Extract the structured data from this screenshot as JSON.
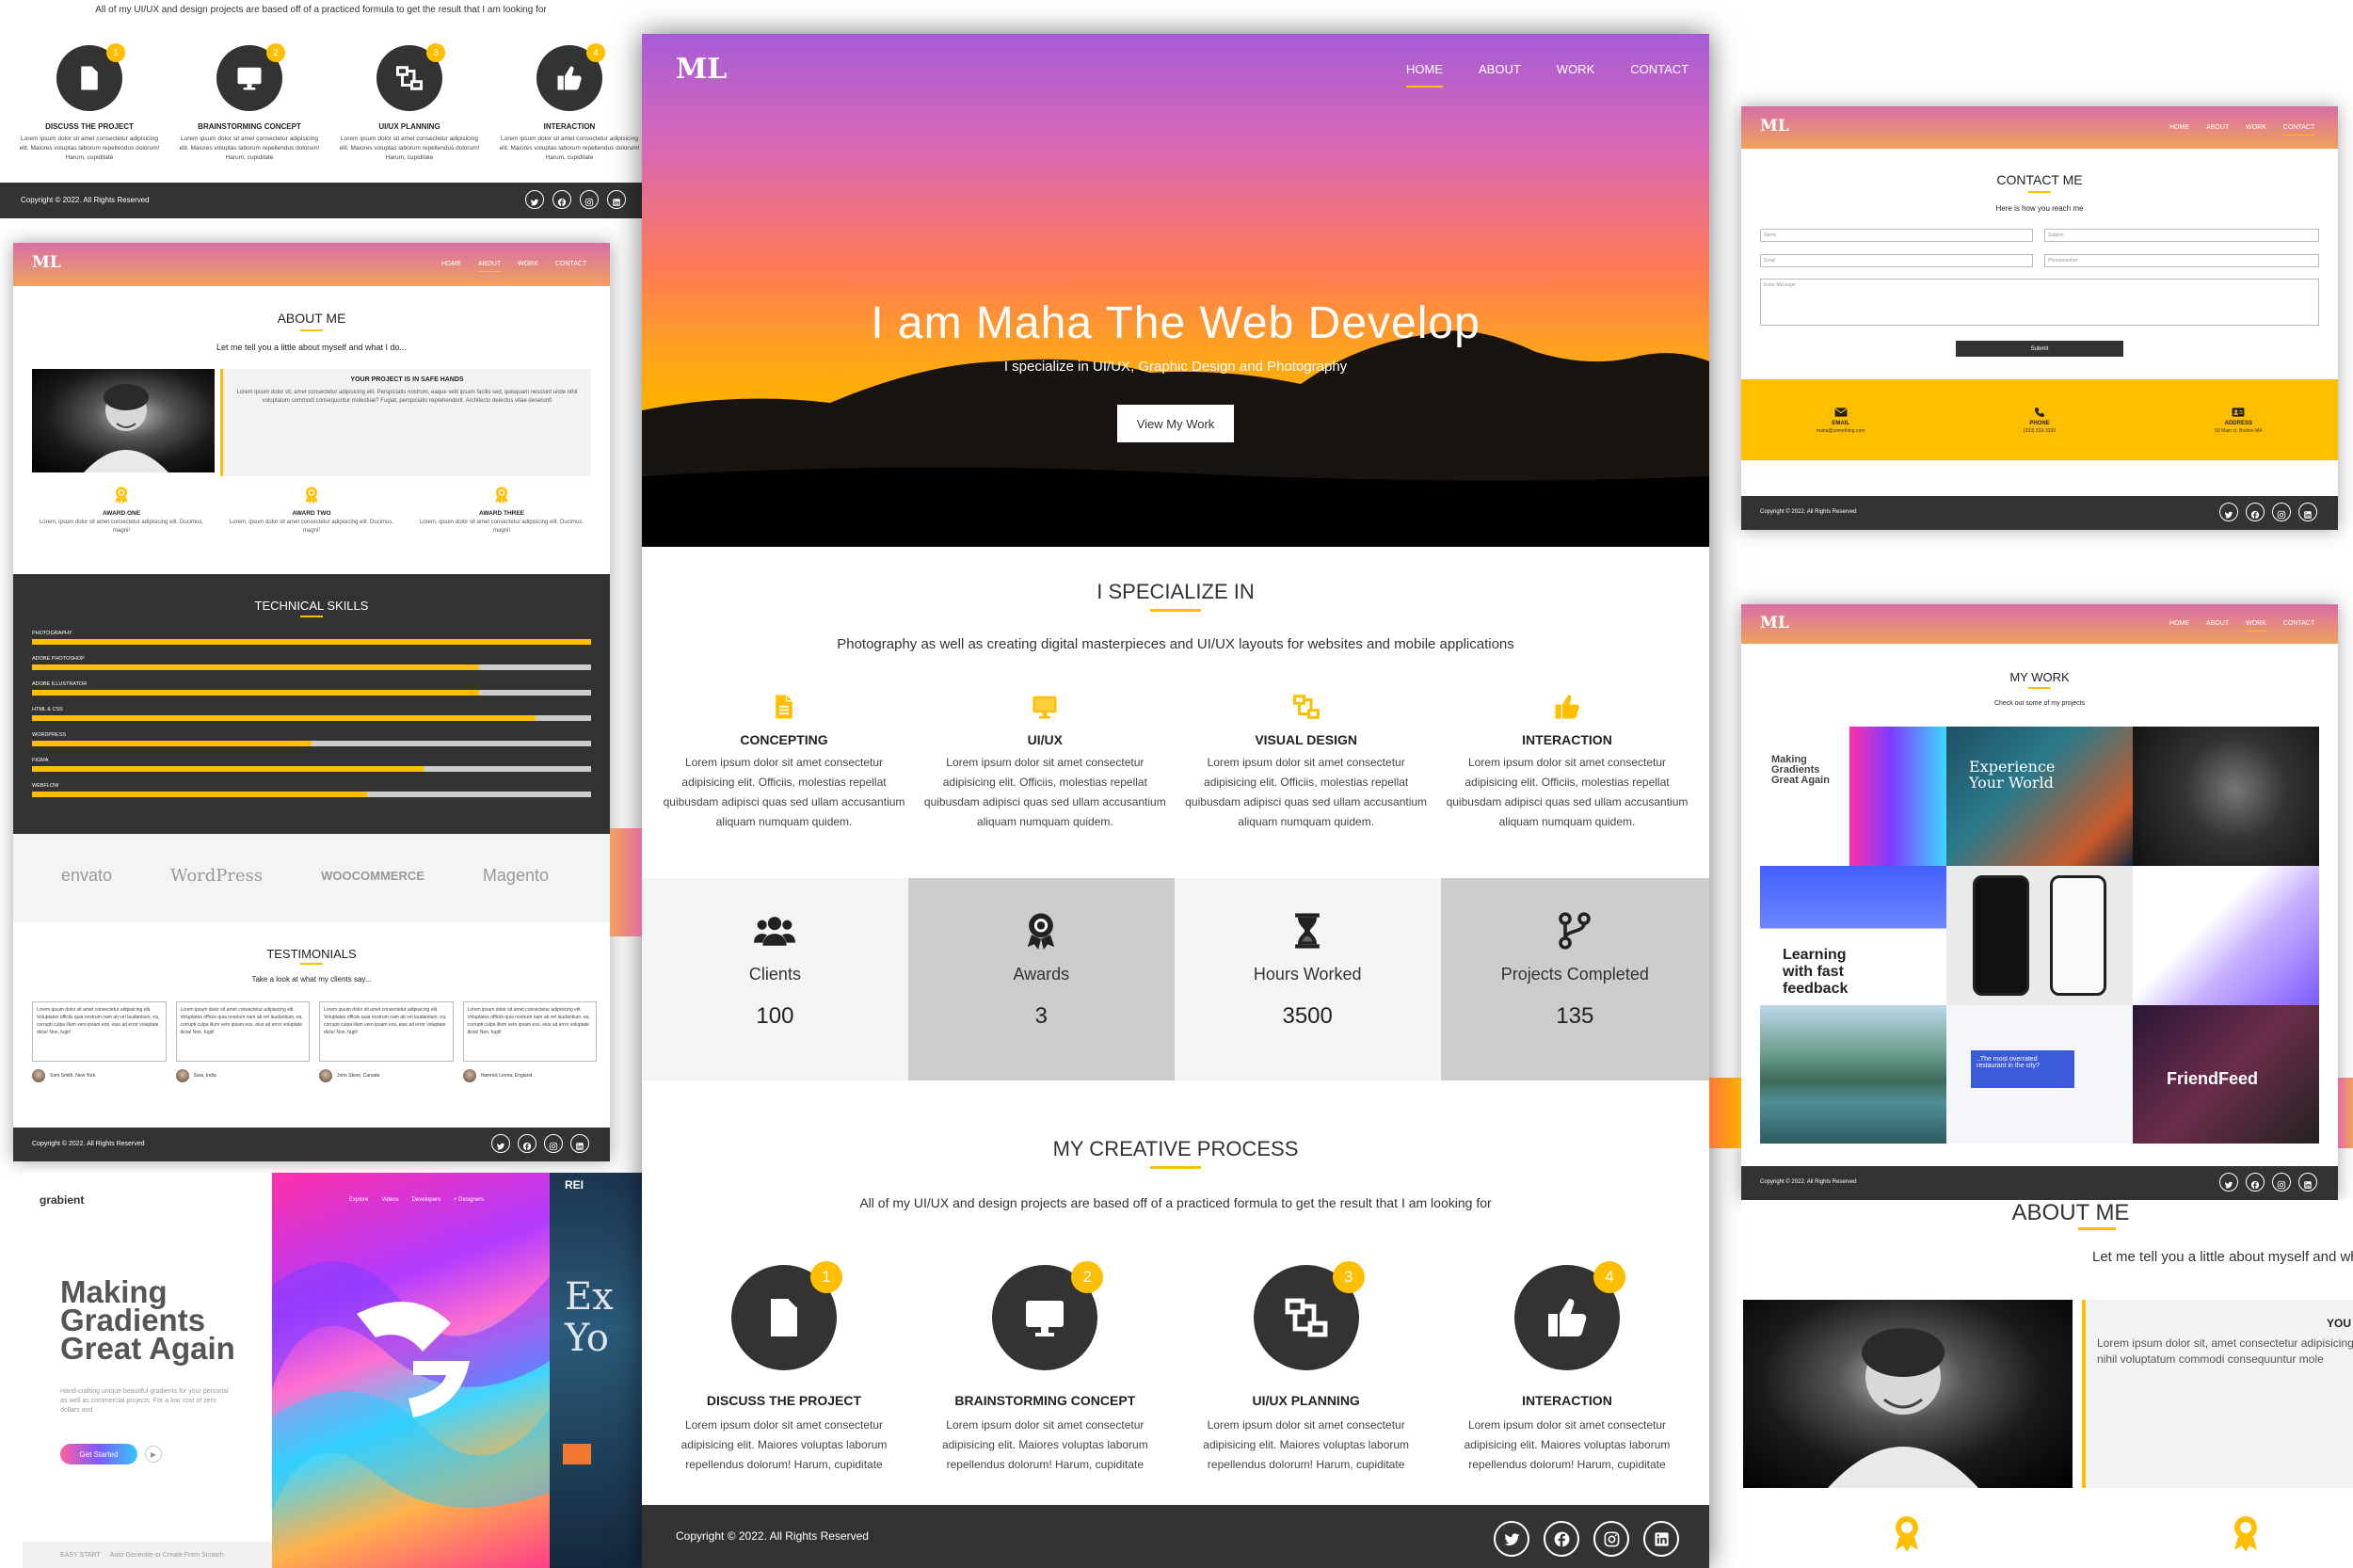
{
  "brand": "ML",
  "nav": [
    "HOME",
    "ABOUT",
    "WORK",
    "CONTACT"
  ],
  "hero": {
    "title": "I am Maha The Web Develop",
    "subtitle": "I specialize in UI/UX, Graphic Design and Photography",
    "button": "View My Work"
  },
  "specialize": {
    "title": "I SPECIALIZE IN",
    "subtitle": "Photography as well as creating digital masterpieces and UI/UX layouts for websites and mobile applications",
    "items": [
      {
        "icon": "file-icon",
        "title": "CONCEPTING",
        "text": "Lorem ipsum dolor sit amet consectetur adipisicing elit. Officiis, molestias repellat quibusdam adipisci quas sed ullam accusantium aliquam numquam quidem."
      },
      {
        "icon": "monitor-icon",
        "title": "UI/UX",
        "text": "Lorem ipsum dolor sit amet consectetur adipisicing elit. Officiis, molestias repellat quibusdam adipisci quas sed ullam accusantium aliquam numquam quidem."
      },
      {
        "icon": "layout-icon",
        "title": "VISUAL DESIGN",
        "text": "Lorem ipsum dolor sit amet consectetur adipisicing elit. Officiis, molestias repellat quibusdam adipisci quas sed ullam accusantium aliquam numquam quidem."
      },
      {
        "icon": "thumbs-up-icon",
        "title": "INTERACTION",
        "text": "Lorem ipsum dolor sit amet consectetur adipisicing elit. Officiis, molestias repellat quibusdam adipisci quas sed ullam accusantium aliquam numquam quidem."
      }
    ]
  },
  "stats": [
    {
      "icon": "users-icon",
      "label": "Clients",
      "value": "100"
    },
    {
      "icon": "award-icon",
      "label": "Awards",
      "value": "3"
    },
    {
      "icon": "hourglass-icon",
      "label": "Hours Worked",
      "value": "3500"
    },
    {
      "icon": "code-branch-icon",
      "label": "Projects Completed",
      "value": "135"
    }
  ],
  "process": {
    "title": "MY CREATIVE PROCESS",
    "subtitle": "All of my UI/UX and design projects are based off of a practiced formula to get the result that I am looking for",
    "items": [
      {
        "num": "1",
        "icon": "file-icon",
        "title": "DISCUSS THE PROJECT",
        "text": "Lorem ipsum dolor sit amet consectetur adipisicing elit. Maiores voluptas laborum repellendus dolorum! Harum, cupiditate"
      },
      {
        "num": "2",
        "icon": "monitor-icon",
        "title": "BRAINSTORMING CONCEPT",
        "text": "Lorem ipsum dolor sit amet consectetur adipisicing elit. Maiores voluptas laborum repellendus dolorum! Harum, cupiditate"
      },
      {
        "num": "3",
        "icon": "layout-icon",
        "title": "UI/UX PLANNING",
        "text": "Lorem ipsum dolor sit amet consectetur adipisicing elit. Maiores voluptas laborum repellendus dolorum! Harum, cupiditate"
      },
      {
        "num": "4",
        "icon": "thumbs-up-icon",
        "title": "INTERACTION",
        "text": "Lorem ipsum dolor sit amet consectetur adipisicing elit. Maiores voluptas laborum repellendus dolorum! Harum, cupiditate"
      }
    ]
  },
  "footer": {
    "copyright": "Copyright © 2022. All Rights Reserved"
  },
  "social": [
    "twitter-icon",
    "facebook-icon",
    "instagram-icon",
    "linkedin-icon"
  ],
  "about": {
    "title": "ABOUT ME",
    "subtitle": "Let me tell you a little about myself and what I do...",
    "subtitle_short": "Let me tell you a little about myself and wh",
    "box_title": "YOUR PROJECT IS IN SAFE HANDS",
    "box_title_short": "YOU",
    "box_text": "Lorem ipsum dolor sit, amet consectetur adipisicing elit. Perspiciatis nostrum, eaque velit ipsam facilis sed, quisquam nesciunt unde nihil voluptatum commodi consequuntur molestiae? Fugiat, perspiciatis reprehenderit. Architecto delectus vitae deserunt!",
    "box_text_short": "Lorem ipsum dolor sit, amet consectetur adipisicing nihil voluptatum commodi consequuntur mole",
    "awards": [
      {
        "title": "AWARD ONE",
        "text": "Lorem, ipsum dolor sit amet consectetur adipisicing elit. Ducimus, magni!"
      },
      {
        "title": "AWARD TWO",
        "text": "Lorem, ipsum dolor sit amet consectetur adipisicing elit. Ducimus, magni!"
      },
      {
        "title": "AWARD THREE",
        "text": "Lorem, ipsum dolor sit amet consectetur adipisicing elit. Ducimus, magni!"
      }
    ]
  },
  "skills": {
    "title": "TECHNICAL SKILLS",
    "items": [
      {
        "name": "PHOTOGRAPHY",
        "level": 1.0
      },
      {
        "name": "ADOBE PHOTOSHOP",
        "level": 0.8
      },
      {
        "name": "ADOBE ILLUSTRATOR",
        "level": 0.8
      },
      {
        "name": "HTML & CSS",
        "level": 0.9
      },
      {
        "name": "WORDPRESS",
        "level": 0.5
      },
      {
        "name": "FIGMA",
        "level": 0.7
      },
      {
        "name": "WEBFLOW",
        "level": 0.6
      }
    ]
  },
  "logos": [
    "envato",
    "WordPress",
    "WOOCOMMERCE",
    "Magento"
  ],
  "testimonials": {
    "title": "TESTIMONIALS",
    "subtitle": "Take a look at what my clients say...",
    "items": [
      {
        "text": "Lorem ipsum dolor sit amet consectetur adipisicing elit. Voluptates officiis quia nostrum nam ab vel laudantium, ea, corrupti culpa illum vero ipsam eos, eius ad error voluptate dicta! Non, fugit!",
        "name": "Sam Smith, New York"
      },
      {
        "text": "Lorem ipsum dolor sit amet consectetur adipisicing elit. Voluptates officiis quia nostrum nam ab vel laudantium, ea, corrupti culpa illum vero ipsam eos, eius ad error voluptate dicta! Non, fugit!",
        "name": "Sara, India"
      },
      {
        "text": "Lorem ipsum dolor sit amet consectetur adipisicing elit. Voluptates officiis quia nostrum nam ab vel laudantium, ea, corrupti culpa illum vero ipsam eos, eius ad error voluptate dicta! Non, fugit!",
        "name": "John Steve, Canada"
      },
      {
        "text": "Lorem ipsum dolor sit amet consectetur adipisicing elit. Voluptates officiis quia nostrum nam ab vel laudantium, ea, corrupti culpa illum vero ipsam eos, eius ad error voluptate dicta! Non, fugit!",
        "name": "Hamrick Leona, England"
      }
    ]
  },
  "contact": {
    "title": "CONTACT ME",
    "subtitle": "Here is how you reach me",
    "placeholders": {
      "name": "Name",
      "subject": "Subject",
      "email": "Email",
      "phone": "Phonenumber",
      "message": "Enter Message"
    },
    "submit": "Submit",
    "info": [
      {
        "icon": "envelope-icon",
        "label": "EMAIL",
        "value": "maha@something.com"
      },
      {
        "icon": "phone-icon",
        "label": "PHONE",
        "value": "(333) 333-3333"
      },
      {
        "icon": "address-card-icon",
        "label": "ADDRESS",
        "value": "50 Main st. Boston MA"
      }
    ]
  },
  "work": {
    "title": "MY WORK",
    "subtitle": "Check out some of my projects",
    "tile_texts": [
      "Making Gradients Great Again",
      "Experience Your World",
      "Learning with fast feedback",
      "FriendFeed",
      "..The most overrated restaurant in the city?"
    ]
  },
  "grabient": {
    "logo": "grabient",
    "title": "Making Gradients Great Again",
    "desc": "Hand-crafting unique beautiful gradients for your personal as well as commercial projects. For a low cost of zero dollars and",
    "button": "Get Started",
    "nav": [
      "Explore",
      "Videos",
      "Developers",
      "+ Designers"
    ],
    "footer": "EASY START",
    "footer_text": "Auto-Generate or Create From Scratch",
    "ocean_title": "Ex Yo",
    "ocean_brand": "REI"
  },
  "colors": {
    "accent": "#ffbf00",
    "dark": "#333333",
    "hero_top": "#a65cd6",
    "hero_mid": "#ff7a55",
    "hero_bottom": "#ffb000"
  }
}
